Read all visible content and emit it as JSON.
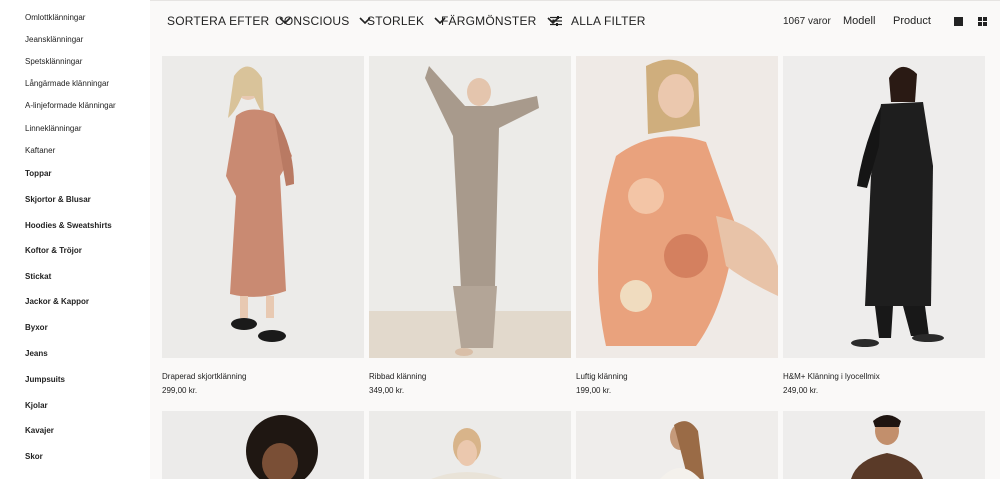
{
  "sidebar": {
    "items": [
      {
        "label": "Omlottklänningar",
        "bold": false
      },
      {
        "label": "Jeansklänningar",
        "bold": false
      },
      {
        "label": "Spetsklänningar",
        "bold": false
      },
      {
        "label": "Långärmade klänningar",
        "bold": false
      },
      {
        "label": "A-linjeformade klänningar",
        "bold": false
      },
      {
        "label": "Linneklänningar",
        "bold": false
      },
      {
        "label": "Kaftaner",
        "bold": false
      },
      {
        "label": "Toppar",
        "bold": true
      },
      {
        "label": "Skjortor & Blusar",
        "bold": true
      },
      {
        "label": "Hoodies & Sweatshirts",
        "bold": true
      },
      {
        "label": "Koftor & Tröjor",
        "bold": true
      },
      {
        "label": "Stickat",
        "bold": true
      },
      {
        "label": "Jackor & Kappor",
        "bold": true
      },
      {
        "label": "Byxor",
        "bold": true
      },
      {
        "label": "Jeans",
        "bold": true
      },
      {
        "label": "Jumpsuits",
        "bold": true
      },
      {
        "label": "Kjolar",
        "bold": true
      },
      {
        "label": "Kavajer",
        "bold": true
      },
      {
        "label": "Skor",
        "bold": true
      }
    ]
  },
  "toolbar": {
    "sort_label": "SORTERA EFTER",
    "conscious_label": "CONSCIOUS",
    "size_label": "STORLEK",
    "color_label": "FÄRGMÖNSTER",
    "filter_label": "ALLA FILTER",
    "count": "1067 varor",
    "view_model": "Modell",
    "view_product": "Product"
  },
  "products": [
    {
      "name": "Draperad skjortklänning",
      "price": "299,00 kr."
    },
    {
      "name": "Ribbad klänning",
      "price": "349,00 kr."
    },
    {
      "name": "Luftig klänning",
      "price": "199,00 kr."
    },
    {
      "name": "H&M+ Klänning i lyocellmix",
      "price": "249,00 kr."
    }
  ],
  "colors": {
    "background": "#faf9f8",
    "text": "#222222",
    "dress_pink": "#c98a72",
    "dress_taupe": "#a89a8c",
    "dress_floral": "#e9a27d",
    "dress_black": "#1e1e1e"
  }
}
